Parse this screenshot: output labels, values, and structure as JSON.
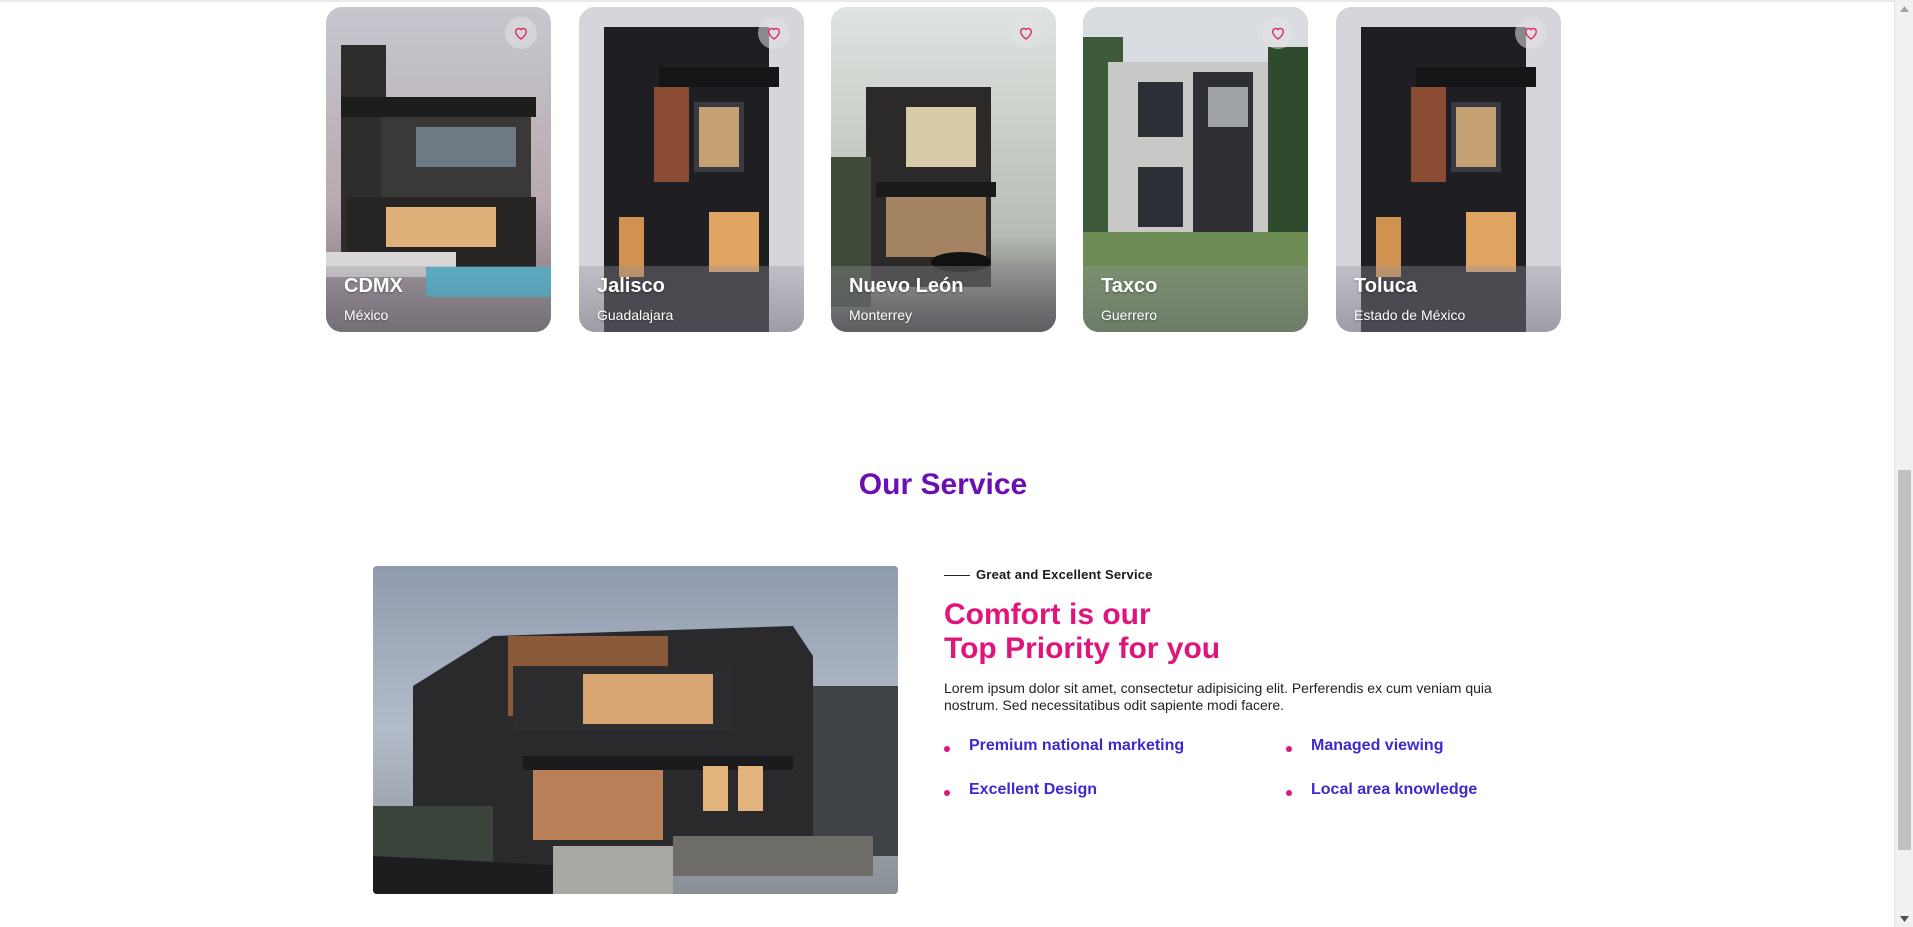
{
  "cards": [
    {
      "city": "CDMX",
      "state": "México"
    },
    {
      "city": "Jalisco",
      "state": "Guadalajara"
    },
    {
      "city": "Nuevo León",
      "state": "Monterrey"
    },
    {
      "city": "Taxco",
      "state": "Guerrero"
    },
    {
      "city": "Toluca",
      "state": "Estado de México"
    }
  ],
  "service": {
    "title": "Our Service",
    "eyebrow": "Great and Excellent Service",
    "headline_line1": "Comfort is our",
    "headline_line2": "Top Priority for you",
    "description": "Lorem ipsum dolor sit amet, consectetur adipisicing elit. Perferendis ex cum veniam quia nostrum. Sed necessitatibus odit sapiente modi facere.",
    "features": [
      "Premium national marketing",
      "Managed viewing",
      "Excellent Design",
      "Local area knowledge"
    ]
  },
  "icons": {
    "favorite": "heart-outline-icon",
    "bullet": "dot-icon",
    "scroll_up": "caret-up-icon",
    "scroll_down": "caret-down-icon"
  },
  "colors": {
    "section_title": "#6b0fb3",
    "headline": "#e0157c",
    "feature_text": "#3d2acd",
    "heart": "#e0245e"
  }
}
